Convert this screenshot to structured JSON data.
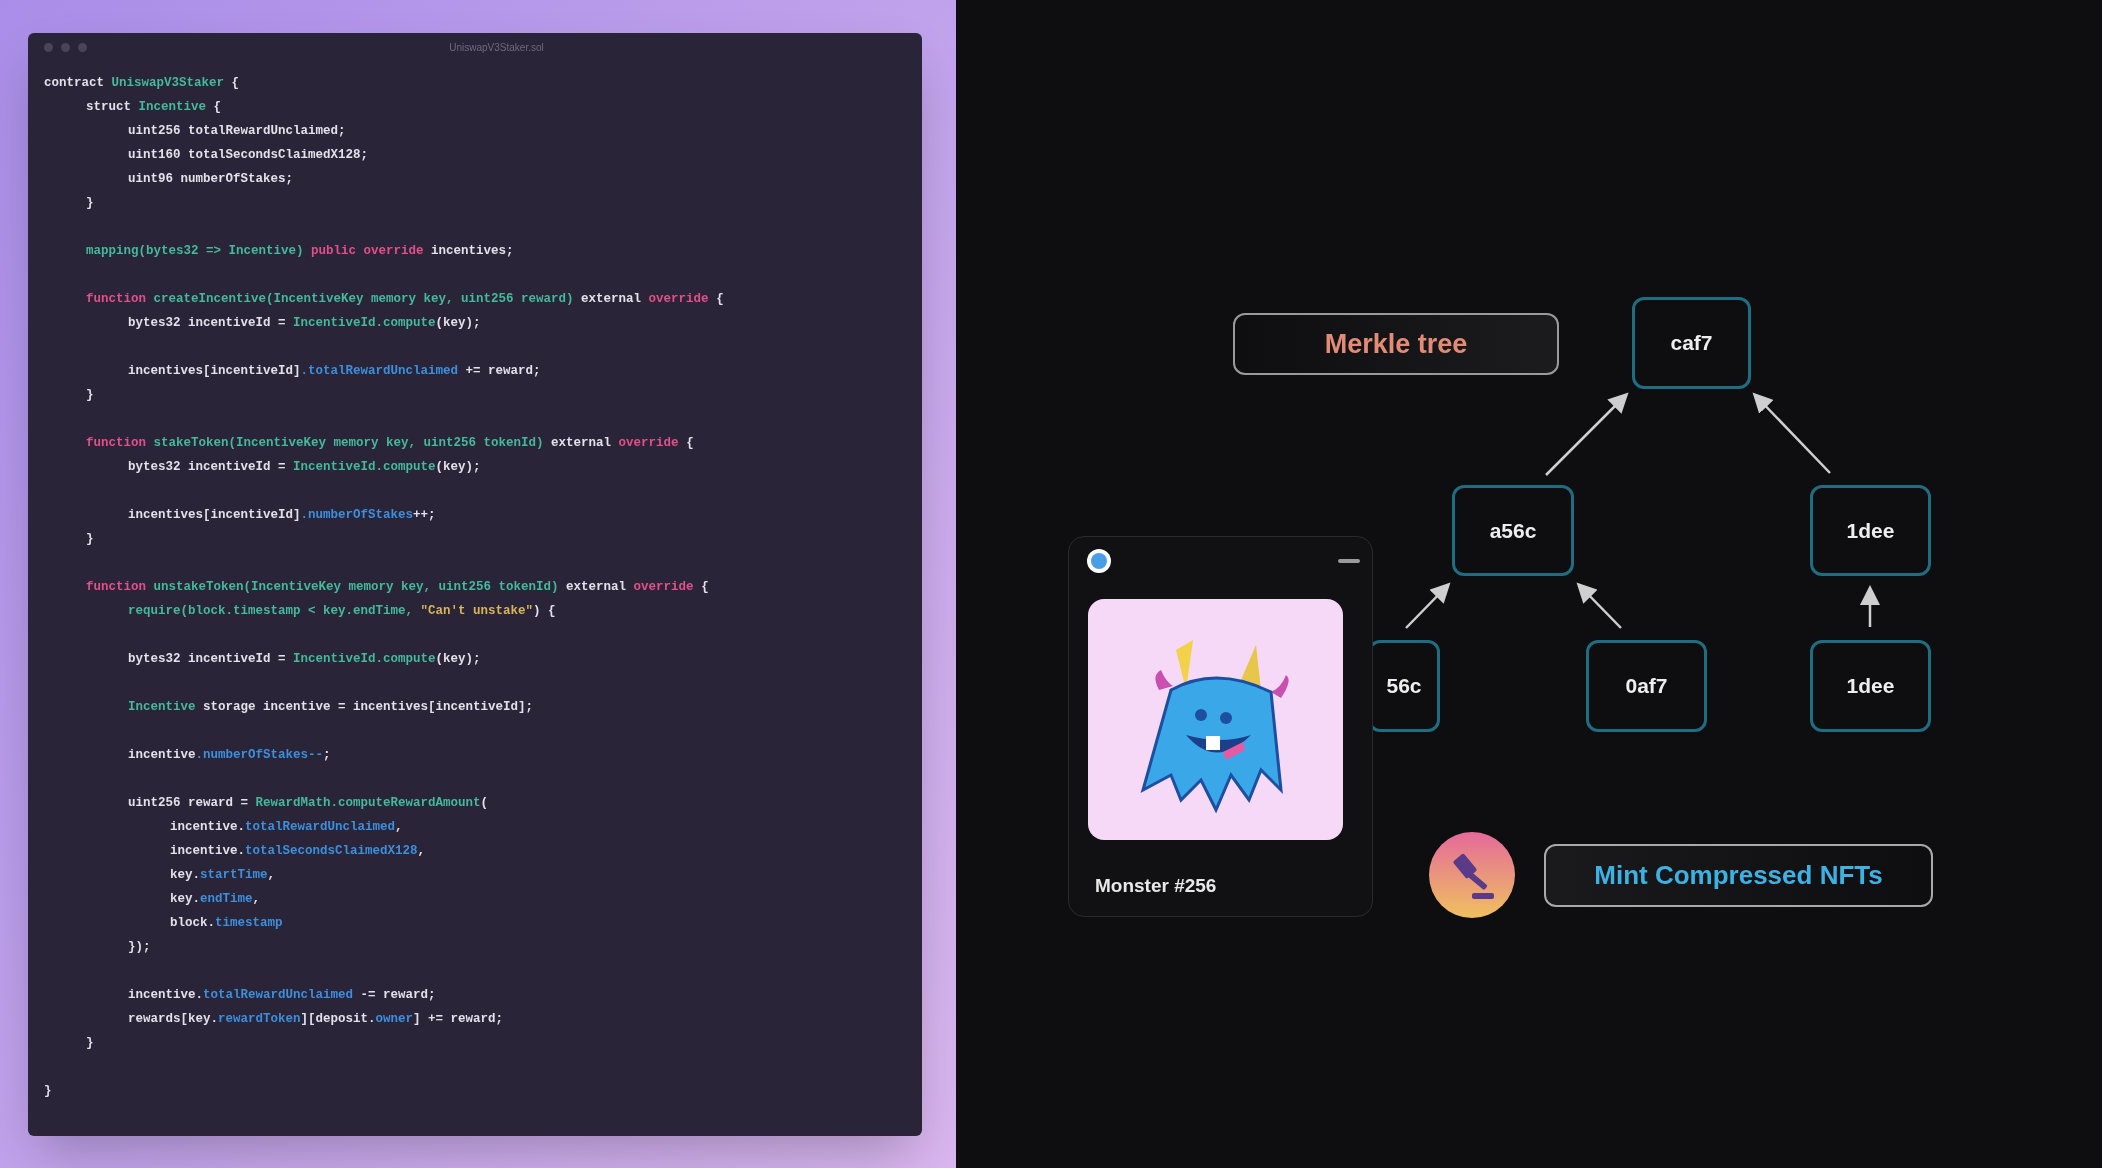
{
  "editor": {
    "title": "UniswapV3Staker.sol",
    "blocks": [
      [
        {
          "tokens": [
            {
              "kind": "plain",
              "text": "contract "
            },
            {
              "kind": "type",
              "text": "UniswapV3Staker"
            },
            {
              "kind": "plain",
              "text": " {"
            }
          ],
          "blocks": [
            [
              {
                "tokens": [
                  {
                    "kind": "plain",
                    "text": "struct "
                  },
                  {
                    "kind": "type",
                    "text": "Incentive"
                  },
                  {
                    "kind": "plain",
                    "text": " {"
                  }
                ],
                "blocks": [
                  [
                    {
                      "tokens": [
                        {
                          "kind": "plain",
                          "text": "uint256 totalRewardUnclaimed;"
                        }
                      ]
                    },
                    {
                      "tokens": [
                        {
                          "kind": "plain",
                          "text": "uint160 totalSecondsClaimedX128;"
                        }
                      ]
                    },
                    {
                      "tokens": [
                        {
                          "kind": "plain",
                          "text": "uint96 numberOfStakes;"
                        }
                      ]
                    }
                  ]
                ]
              },
              {
                "tokens": [
                  {
                    "kind": "plain",
                    "text": "}"
                  }
                ]
              }
            ],
            [
              {
                "tokens": [
                  {
                    "kind": "type",
                    "text": "mapping(bytes32 => Incentive) "
                  },
                  {
                    "kind": "keyword",
                    "text": "public override"
                  },
                  {
                    "kind": "plain",
                    "text": " incentives;"
                  }
                ]
              }
            ],
            [
              {
                "tokens": [
                  {
                    "kind": "keyword",
                    "text": "function "
                  },
                  {
                    "kind": "type",
                    "text": "createIncentive(IncentiveKey memory key, uint256 reward)"
                  },
                  {
                    "kind": "plain",
                    "text": " external "
                  },
                  {
                    "kind": "keyword",
                    "text": "override"
                  },
                  {
                    "kind": "plain",
                    "text": " {"
                  }
                ],
                "blocks": [
                  [
                    {
                      "tokens": [
                        {
                          "kind": "plain",
                          "text": "bytes32 incentiveId = "
                        },
                        {
                          "kind": "type",
                          "text": "IncentiveId.compute"
                        },
                        {
                          "kind": "plain",
                          "text": "(key);"
                        }
                      ]
                    }
                  ],
                  [
                    {
                      "tokens": [
                        {
                          "kind": "plain",
                          "text": "incentives[incentiveId]"
                        },
                        {
                          "kind": "member",
                          "text": ".totalRewardUnclaimed"
                        },
                        {
                          "kind": "plain",
                          "text": " += reward;"
                        }
                      ]
                    }
                  ]
                ]
              },
              {
                "tokens": [
                  {
                    "kind": "plain",
                    "text": "}"
                  }
                ]
              }
            ],
            [
              {
                "tokens": [
                  {
                    "kind": "keyword",
                    "text": "function "
                  },
                  {
                    "kind": "type",
                    "text": "stakeToken(IncentiveKey memory key, uint256 tokenId)"
                  },
                  {
                    "kind": "plain",
                    "text": " external "
                  },
                  {
                    "kind": "keyword",
                    "text": "override"
                  },
                  {
                    "kind": "plain",
                    "text": " {"
                  }
                ],
                "blocks": [
                  [
                    {
                      "tokens": [
                        {
                          "kind": "plain",
                          "text": "bytes32 incentiveId = "
                        },
                        {
                          "kind": "type",
                          "text": "IncentiveId.compute"
                        },
                        {
                          "kind": "plain",
                          "text": "(key);"
                        }
                      ]
                    }
                  ],
                  [
                    {
                      "tokens": [
                        {
                          "kind": "plain",
                          "text": "incentives[incentiveId]"
                        },
                        {
                          "kind": "member",
                          "text": ".numberOfStakes"
                        },
                        {
                          "kind": "plain",
                          "text": "++;"
                        }
                      ]
                    }
                  ]
                ]
              },
              {
                "tokens": [
                  {
                    "kind": "plain",
                    "text": "}"
                  }
                ]
              }
            ],
            [
              {
                "tokens": [
                  {
                    "kind": "keyword",
                    "text": "function "
                  },
                  {
                    "kind": "type",
                    "text": "unstakeToken(IncentiveKey memory key, uint256 tokenId)"
                  },
                  {
                    "kind": "plain",
                    "text": " external "
                  },
                  {
                    "kind": "keyword",
                    "text": "override"
                  },
                  {
                    "kind": "plain",
                    "text": " {"
                  }
                ],
                "blocks": [
                  [
                    {
                      "tokens": [
                        {
                          "kind": "type",
                          "text": "require(block.timestamp < key.endTime, "
                        },
                        {
                          "kind": "string",
                          "text": "\"Can't unstake\""
                        },
                        {
                          "kind": "plain",
                          "text": ") {"
                        }
                      ]
                    }
                  ],
                  [
                    {
                      "tokens": [
                        {
                          "kind": "plain",
                          "text": "bytes32 incentiveId = "
                        },
                        {
                          "kind": "type",
                          "text": "IncentiveId.compute"
                        },
                        {
                          "kind": "plain",
                          "text": "(key);"
                        }
                      ]
                    }
                  ],
                  [
                    {
                      "tokens": [
                        {
                          "kind": "type",
                          "text": "Incentive"
                        },
                        {
                          "kind": "plain",
                          "text": " storage incentive = incentives[incentiveId];"
                        }
                      ]
                    }
                  ],
                  [
                    {
                      "tokens": [
                        {
                          "kind": "plain",
                          "text": "incentive"
                        },
                        {
                          "kind": "member",
                          "text": ".numberOfStakes--"
                        },
                        {
                          "kind": "plain",
                          "text": ";"
                        }
                      ]
                    }
                  ],
                  [
                    {
                      "tokens": [
                        {
                          "kind": "plain",
                          "text": "uint256 reward = "
                        },
                        {
                          "kind": "type",
                          "text": "RewardMath.computeRewardAmount"
                        },
                        {
                          "kind": "plain",
                          "text": "("
                        }
                      ],
                      "blocks": [
                        [
                          {
                            "tokens": [
                              {
                                "kind": "plain",
                                "text": "incentive."
                              },
                              {
                                "kind": "member",
                                "text": "totalRewardUnclaimed"
                              },
                              {
                                "kind": "plain",
                                "text": ","
                              }
                            ]
                          },
                          {
                            "tokens": [
                              {
                                "kind": "plain",
                                "text": "incentive."
                              },
                              {
                                "kind": "member",
                                "text": "totalSecondsClaimedX128"
                              },
                              {
                                "kind": "plain",
                                "text": ","
                              }
                            ]
                          },
                          {
                            "tokens": [
                              {
                                "kind": "plain",
                                "text": "key."
                              },
                              {
                                "kind": "member",
                                "text": "startTime"
                              },
                              {
                                "kind": "plain",
                                "text": ","
                              }
                            ]
                          },
                          {
                            "tokens": [
                              {
                                "kind": "plain",
                                "text": "key."
                              },
                              {
                                "kind": "member",
                                "text": "endTime"
                              },
                              {
                                "kind": "plain",
                                "text": ","
                              }
                            ]
                          },
                          {
                            "tokens": [
                              {
                                "kind": "plain",
                                "text": "block."
                              },
                              {
                                "kind": "member",
                                "text": "timestamp"
                              }
                            ]
                          }
                        ]
                      ]
                    },
                    {
                      "tokens": [
                        {
                          "kind": "plain",
                          "text": "});"
                        }
                      ]
                    }
                  ],
                  [
                    {
                      "tokens": [
                        {
                          "kind": "plain",
                          "text": "incentive."
                        },
                        {
                          "kind": "member",
                          "text": "totalRewardUnclaimed"
                        },
                        {
                          "kind": "plain",
                          "text": " -= reward;"
                        }
                      ]
                    },
                    {
                      "tokens": [
                        {
                          "kind": "plain",
                          "text": "rewards[key."
                        },
                        {
                          "kind": "member",
                          "text": "rewardToken"
                        },
                        {
                          "kind": "plain",
                          "text": "][deposit."
                        },
                        {
                          "kind": "member",
                          "text": "owner"
                        },
                        {
                          "kind": "plain",
                          "text": "] += reward;"
                        }
                      ]
                    }
                  ]
                ]
              },
              {
                "tokens": [
                  {
                    "kind": "plain",
                    "text": "}"
                  }
                ]
              }
            ]
          ]
        }
      ],
      [
        {
          "tokens": [
            {
              "kind": "plain",
              "text": "}"
            }
          ]
        }
      ]
    ]
  },
  "diagram": {
    "title": "Merkle tree",
    "nodes": [
      {
        "label": "caf7"
      },
      {
        "label": "a56c"
      },
      {
        "label": "1dee"
      },
      {
        "label": "56c"
      },
      {
        "label": "0af7"
      },
      {
        "label": "1dee"
      }
    ],
    "nft_card": {
      "name": "Monster #256"
    },
    "mint_button": "Mint Compressed NFTs"
  }
}
